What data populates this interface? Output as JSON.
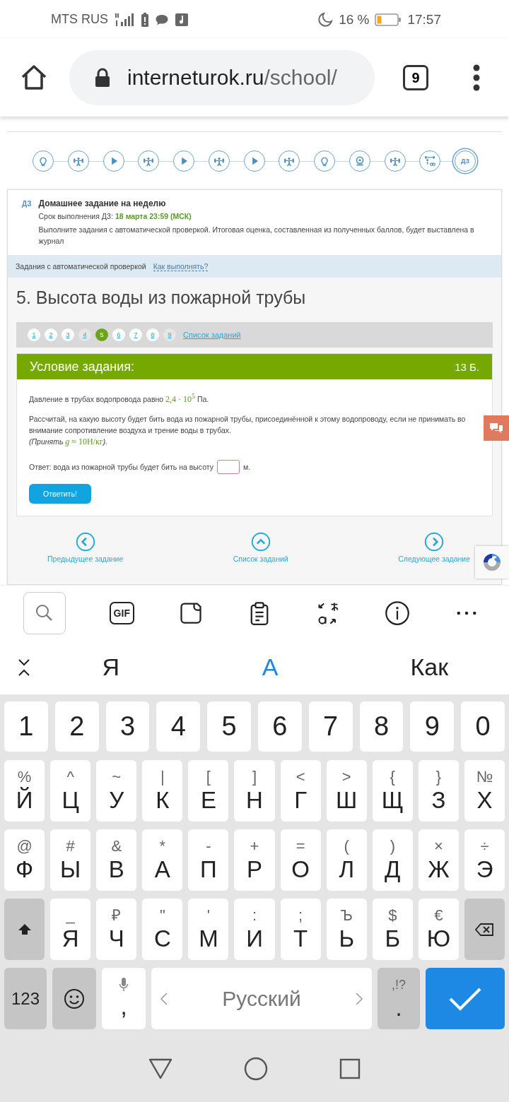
{
  "status_bar": {
    "carrier": "MTS RUS",
    "battery_percent": "16 %",
    "time": "17:57"
  },
  "browser": {
    "url_host": "interneturok.ru",
    "url_path": "/school/",
    "tab_count": "9"
  },
  "lesson_steps": [
    {
      "kind": "idea",
      "selected": false
    },
    {
      "kind": "exercise",
      "selected": false
    },
    {
      "kind": "video",
      "selected": false
    },
    {
      "kind": "exercise",
      "selected": false
    },
    {
      "kind": "video",
      "selected": false
    },
    {
      "kind": "exercise",
      "selected": false
    },
    {
      "kind": "video",
      "selected": false
    },
    {
      "kind": "exercise",
      "selected": false
    },
    {
      "kind": "idea",
      "selected": false
    },
    {
      "kind": "webcam",
      "selected": false
    },
    {
      "kind": "exercise",
      "selected": false
    },
    {
      "kind": "trainer",
      "selected": false
    },
    {
      "kind": "homework",
      "label": "ДЗ",
      "selected": true
    }
  ],
  "homework": {
    "tag": "ДЗ",
    "title": "Домашнее задание на неделю",
    "deadline_label": "Срок выполнения ДЗ:",
    "deadline": "18 марта 23:59 (МСК)",
    "description": "Выполните задания с автоматической проверкой. Итоговая оценка, составленная из полученных баллов, будет выставлена в журнал"
  },
  "info_band": {
    "text": "Задания с автоматической проверкой",
    "link": "Как выполнять?"
  },
  "task_title": "5. Высота воды из пожарной трубы",
  "task_pages": [
    {
      "label": "1",
      "selected": false,
      "dimmed": false
    },
    {
      "label": "2",
      "selected": false,
      "dimmed": false
    },
    {
      "label": "3",
      "selected": false,
      "dimmed": false
    },
    {
      "label": "4",
      "selected": false,
      "dimmed": true
    },
    {
      "label": "5",
      "selected": true,
      "dimmed": false
    },
    {
      "label": "6",
      "selected": false,
      "dimmed": false
    },
    {
      "label": "7",
      "selected": false,
      "dimmed": false
    },
    {
      "label": "8",
      "selected": false,
      "dimmed": false
    },
    {
      "label": "9",
      "selected": false,
      "dimmed": true
    }
  ],
  "task_list_link": "Список заданий",
  "condition": {
    "heading": "Условие задания:",
    "points": "13 Б.",
    "paragraphs": [
      [
        {
          "kind": "text",
          "text": "Давление в трубах водопровода равно "
        },
        {
          "kind": "formula",
          "text": "2,4 · 10$^{5}$"
        },
        {
          "kind": "text",
          "text": " Па."
        }
      ],
      [
        {
          "kind": "text",
          "text": "Рассчитай, на какую высоту будет бить вода из пожарной трубы, присоединённой к этому водопроводу, если не принимать во внимание сопротивление воздуха и трение воды в трубах."
        },
        {
          "kind": "break"
        },
        {
          "kind": "italic",
          "text": "(Принять "
        },
        {
          "kind": "formula",
          "text": "*g* ≈ 10Н/кг"
        },
        {
          "kind": "italic",
          "text": ")."
        }
      ]
    ],
    "answer_label": "Ответ: вода из пожарной трубы будет бить на высоту",
    "answer_unit": "м.",
    "submit": "Ответить!"
  },
  "task_nav": [
    {
      "kind": "prev",
      "label": "Предыдущее задание"
    },
    {
      "kind": "list",
      "label": "Список заданий"
    },
    {
      "kind": "next",
      "label": "Следующее задание"
    }
  ],
  "keyboard_toolbar": [
    {
      "kind": "search",
      "selected": true
    },
    {
      "kind": "gif",
      "label": "GIF",
      "selected": false
    },
    {
      "kind": "sticker",
      "selected": false
    },
    {
      "kind": "clipboard",
      "selected": false
    },
    {
      "kind": "translate",
      "selected": false
    },
    {
      "kind": "info",
      "selected": false
    },
    {
      "kind": "more",
      "selected": false
    }
  ],
  "suggestions": [
    {
      "text": "Я",
      "selected": false
    },
    {
      "text": "А",
      "selected": true
    },
    {
      "text": "Как",
      "selected": false
    }
  ],
  "keyboard": {
    "number_row": [
      "1",
      "2",
      "3",
      "4",
      "5",
      "6",
      "7",
      "8",
      "9",
      "0"
    ],
    "rows": [
      [
        {
          "main": "Й",
          "alt": "%"
        },
        {
          "main": "Ц",
          "alt": "^"
        },
        {
          "main": "У",
          "alt": "~"
        },
        {
          "main": "К",
          "alt": "|"
        },
        {
          "main": "Е",
          "alt": "["
        },
        {
          "main": "Н",
          "alt": "]"
        },
        {
          "main": "Г",
          "alt": "<"
        },
        {
          "main": "Ш",
          "alt": ">"
        },
        {
          "main": "Щ",
          "alt": "{"
        },
        {
          "main": "З",
          "alt": "}"
        },
        {
          "main": "Х",
          "alt": "№"
        }
      ],
      [
        {
          "main": "Ф",
          "alt": "@"
        },
        {
          "main": "Ы",
          "alt": "#"
        },
        {
          "main": "В",
          "alt": "&"
        },
        {
          "main": "А",
          "alt": "*"
        },
        {
          "main": "П",
          "alt": "-"
        },
        {
          "main": "Р",
          "alt": "+"
        },
        {
          "main": "О",
          "alt": "="
        },
        {
          "main": "Л",
          "alt": "("
        },
        {
          "main": "Д",
          "alt": ")"
        },
        {
          "main": "Ж",
          "alt": "×"
        },
        {
          "main": "Э",
          "alt": "÷"
        }
      ],
      [
        {
          "kind": "shift"
        },
        {
          "main": "Я",
          "alt": "_"
        },
        {
          "main": "Ч",
          "alt": "₽"
        },
        {
          "main": "С",
          "alt": "\""
        },
        {
          "main": "М",
          "alt": "'"
        },
        {
          "main": "И",
          "alt": ":"
        },
        {
          "main": "Т",
          "alt": ";"
        },
        {
          "main": "Ь",
          "alt": "Ъ"
        },
        {
          "main": "Б",
          "alt": "$"
        },
        {
          "main": "Ю",
          "alt": "€"
        },
        {
          "kind": "backspace"
        }
      ]
    ],
    "bottom_row": [
      {
        "kind": "mode",
        "main": "123"
      },
      {
        "kind": "emoji"
      },
      {
        "kind": "comma",
        "main": ","
      },
      {
        "kind": "space",
        "main": "Русский"
      },
      {
        "kind": "period",
        "main": ".",
        "alt": ",!?"
      },
      {
        "kind": "enter"
      }
    ]
  }
}
